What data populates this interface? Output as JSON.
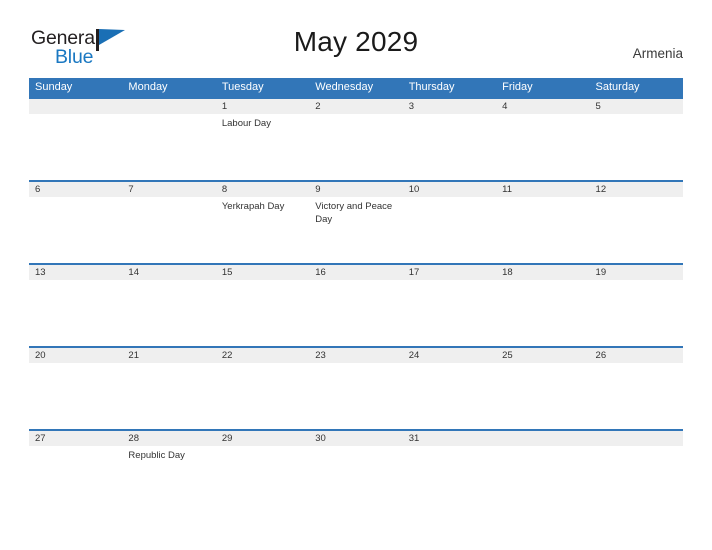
{
  "brand": {
    "name_part1": "General",
    "name_part2": "Blue",
    "flag_icon": "blue-flag-triangle",
    "color_dark": "#231f20",
    "color_blue": "#1a78c2"
  },
  "header": {
    "title": "May 2029",
    "country": "Armenia"
  },
  "theme": {
    "header_blue": "#3276b8",
    "date_band_gray": "#efefef",
    "text": "#333333"
  },
  "weekdays": [
    "Sunday",
    "Monday",
    "Tuesday",
    "Wednesday",
    "Thursday",
    "Friday",
    "Saturday"
  ],
  "weeks": [
    {
      "dates": [
        "",
        "",
        "1",
        "2",
        "3",
        "4",
        "5"
      ],
      "events": [
        "",
        "",
        "Labour Day",
        "",
        "",
        "",
        ""
      ]
    },
    {
      "dates": [
        "6",
        "7",
        "8",
        "9",
        "10",
        "11",
        "12"
      ],
      "events": [
        "",
        "",
        "Yerkrapah Day",
        "Victory and Peace Day",
        "",
        "",
        ""
      ]
    },
    {
      "dates": [
        "13",
        "14",
        "15",
        "16",
        "17",
        "18",
        "19"
      ],
      "events": [
        "",
        "",
        "",
        "",
        "",
        "",
        ""
      ]
    },
    {
      "dates": [
        "20",
        "21",
        "22",
        "23",
        "24",
        "25",
        "26"
      ],
      "events": [
        "",
        "",
        "",
        "",
        "",
        "",
        ""
      ]
    },
    {
      "dates": [
        "27",
        "28",
        "29",
        "30",
        "31",
        "",
        ""
      ],
      "events": [
        "",
        "Republic Day",
        "",
        "",
        "",
        "",
        ""
      ]
    }
  ]
}
